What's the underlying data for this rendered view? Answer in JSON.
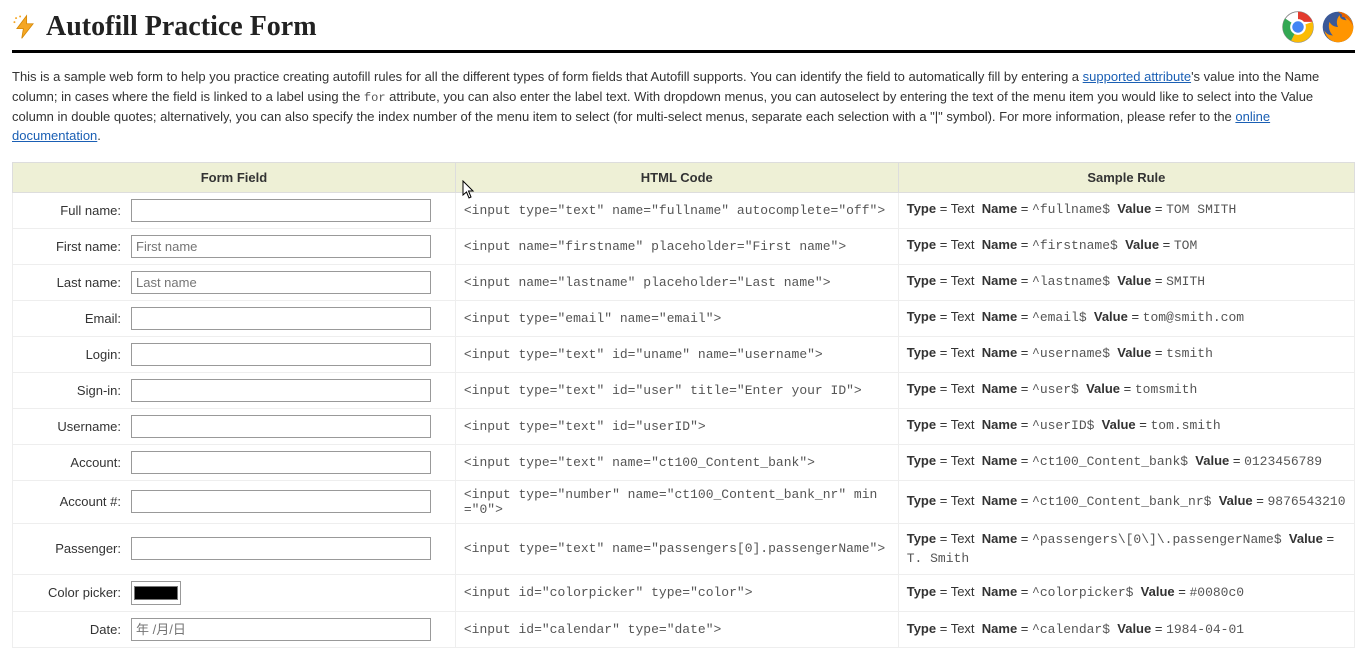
{
  "header": {
    "title": "Autofill Practice Form"
  },
  "intro": {
    "p1a": "This is a sample web form to help you practice creating autofill rules for all the different types of form fields that Autofill supports. You can identify the field to automatically fill by entering a ",
    "link1": "supported attribute",
    "p1b": "'s value into the Name column; in cases where the field is linked to a label using the ",
    "code1": "for",
    "p1c": " attribute, you can also enter the label text. With dropdown menus, you can autoselect by entering the text of the menu item you would like to select into the Value column in double quotes; alternatively, you can also specify the index number of the menu item to select (for multi-select menus, separate each selection with a \"|\" symbol). For more information, please refer to the ",
    "link2": "online documentation",
    "p1d": "."
  },
  "table": {
    "headers": {
      "field": "Form Field",
      "code": "HTML Code",
      "rule": "Sample Rule"
    },
    "labels": {
      "type": "Type",
      "name": "Name",
      "value": "Value",
      "eq": " = "
    },
    "rows": [
      {
        "label": "Full name:",
        "input_type": "text",
        "placeholder": "",
        "html": "<input type=\"text\" name=\"fullname\" autocomplete=\"off\">",
        "rule_type": "Text",
        "rule_name": "^fullname$",
        "rule_value": "TOM SMITH"
      },
      {
        "label": "First name:",
        "input_type": "text",
        "placeholder": "First name",
        "html": "<input name=\"firstname\" placeholder=\"First name\">",
        "rule_type": "Text",
        "rule_name": "^firstname$",
        "rule_value": "TOM"
      },
      {
        "label": "Last name:",
        "input_type": "text",
        "placeholder": "Last name",
        "html": "<input name=\"lastname\" placeholder=\"Last name\">",
        "rule_type": "Text",
        "rule_name": "^lastname$",
        "rule_value": "SMITH"
      },
      {
        "label": "Email:",
        "input_type": "email",
        "placeholder": "",
        "html": "<input type=\"email\" name=\"email\">",
        "rule_type": "Text",
        "rule_name": "^email$",
        "rule_value": "tom@smith.com"
      },
      {
        "label": "Login:",
        "input_type": "text",
        "placeholder": "",
        "html": "<input type=\"text\" id=\"uname\" name=\"username\">",
        "rule_type": "Text",
        "rule_name": "^username$",
        "rule_value": "tsmith"
      },
      {
        "label": "Sign-in:",
        "input_type": "text",
        "placeholder": "",
        "html": "<input type=\"text\" id=\"user\" title=\"Enter your ID\">",
        "rule_type": "Text",
        "rule_name": "^user$",
        "rule_value": "tomsmith"
      },
      {
        "label": "Username:",
        "input_type": "text",
        "placeholder": "",
        "html": "<input type=\"text\" id=\"userID\">",
        "rule_type": "Text",
        "rule_name": "^userID$",
        "rule_value": "tom.smith"
      },
      {
        "label": "Account:",
        "input_type": "text",
        "placeholder": "",
        "html": "<input type=\"text\" name=\"ct100_Content_bank\">",
        "rule_type": "Text",
        "rule_name": "^ct100_Content_bank$",
        "rule_value": "0123456789"
      },
      {
        "label": "Account #:",
        "input_type": "number",
        "placeholder": "",
        "html": "<input type=\"number\" name=\"ct100_Content_bank_nr\" min=\"0\">",
        "rule_type": "Text",
        "rule_name": "^ct100_Content_bank_nr$",
        "rule_value": "9876543210"
      },
      {
        "label": "Passenger:",
        "input_type": "text",
        "placeholder": "",
        "html": "<input type=\"text\" name=\"passengers[0].passengerName\">",
        "rule_type": "Text",
        "rule_name": "^passengers\\[0\\]\\.passengerName$",
        "rule_value": "T. Smith"
      },
      {
        "label": "Color picker:",
        "input_type": "color",
        "placeholder": "",
        "html": "<input id=\"colorpicker\" type=\"color\">",
        "rule_type": "Text",
        "rule_name": "^colorpicker$",
        "rule_value": "#0080c0"
      },
      {
        "label": "Date:",
        "input_type": "date",
        "placeholder": "年 /月/日",
        "html": "<input id=\"calendar\" type=\"date\">",
        "rule_type": "Text",
        "rule_name": "^calendar$",
        "rule_value": "1984-04-01"
      }
    ]
  }
}
